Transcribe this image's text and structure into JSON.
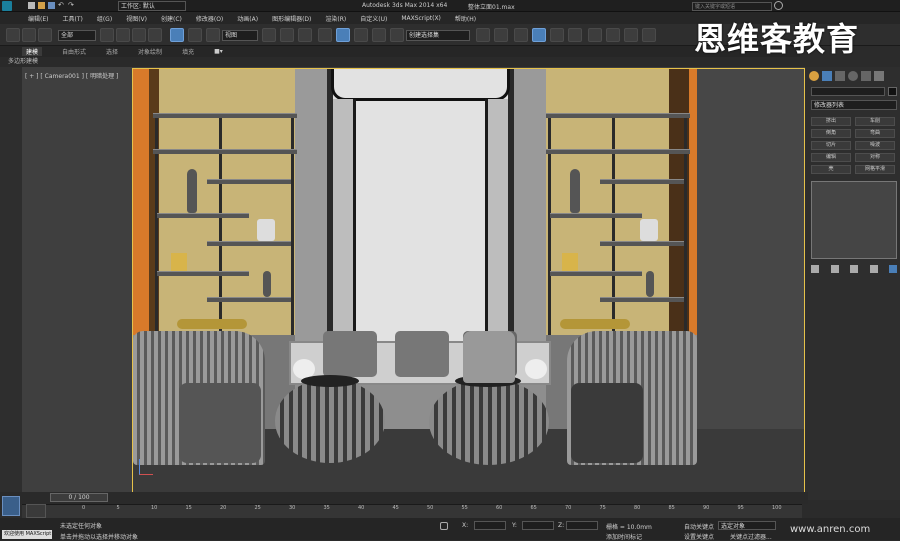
{
  "titlebar": {
    "workspace_label": "工作区: 默认",
    "app_title": "Autodesk 3ds Max  2014 x64",
    "file_name": "整体立面01.max",
    "search_placeholder": "键入关键字或短语"
  },
  "watermark": "恩维客教育",
  "menu": [
    "编辑(E)",
    "工具(T)",
    "组(G)",
    "视图(V)",
    "创建(C)",
    "修改器(O)",
    "动画(A)",
    "图形编辑器(D)",
    "渲染(R)",
    "自定义(U)",
    "MAXScript(X)",
    "帮助(H)"
  ],
  "toolbar": {
    "filter_label": "全部",
    "refcoord_label": "视图",
    "named_sel_label": "创建选择集"
  },
  "ribbon": {
    "tabs": [
      "建模",
      "自由形式",
      "选择",
      "对象绘制",
      "填充"
    ],
    "subtitle": "多边形建模"
  },
  "viewport": {
    "label": "[ + ] [ Camera001 ] [ 明暗处理 ]"
  },
  "cmdpanel": {
    "dropdown_label": "修改器列表",
    "buttons": [
      [
        "挤出",
        "车削"
      ],
      [
        "倒角",
        "弯曲"
      ],
      [
        "切片",
        "噪波"
      ],
      [
        "编辑",
        "对称"
      ],
      [
        "壳",
        "网格平滑"
      ]
    ]
  },
  "timeline": {
    "frame_label": "0 / 100",
    "ticks": [
      "0",
      "5",
      "10",
      "15",
      "20",
      "25",
      "30",
      "35",
      "40",
      "45",
      "50",
      "55",
      "60",
      "65",
      "70",
      "75",
      "80",
      "85",
      "90",
      "95",
      "100"
    ]
  },
  "status": {
    "script_label": "欢迎使用 MAXScript",
    "selection": "未选定任何对象",
    "hint": "单击并拖动以选择并移动对象",
    "x_label": "X:",
    "y_label": "Y:",
    "z_label": "Z:",
    "grid": "栅格 = 10.0mm",
    "autokey": "自动关键点",
    "autokey_value": "选定对象",
    "setkey": "设置关键点",
    "keyfilter": "关键点过滤器...",
    "addtime": "添加时间标记",
    "site": "www.anren.com"
  },
  "colors": {
    "accent": "#4a7fb8",
    "viewport_border": "#e6c24a",
    "wall_yellow": "#c8b477",
    "wall_orange": "#d87a2a"
  }
}
